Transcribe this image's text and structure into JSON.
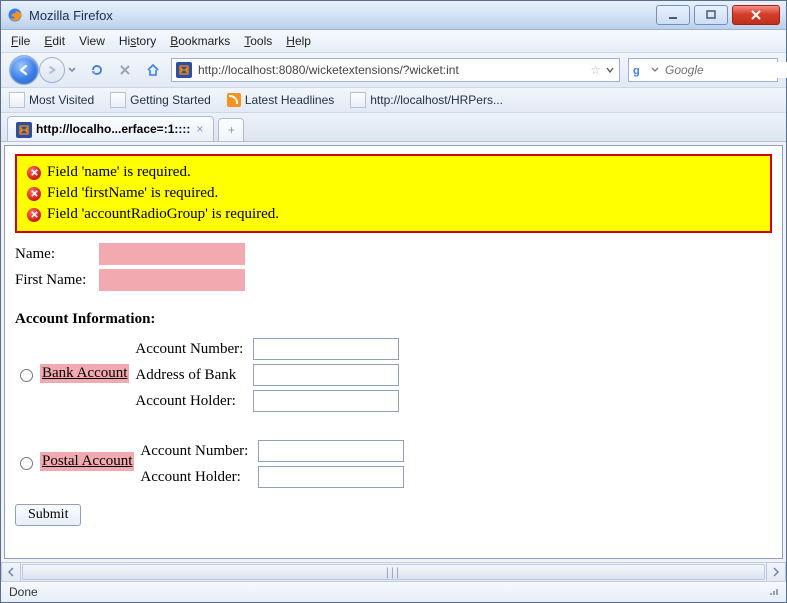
{
  "window": {
    "title": "Mozilla Firefox"
  },
  "menu": {
    "file": "File",
    "edit": "Edit",
    "view": "View",
    "history": "History",
    "bookmarks": "Bookmarks",
    "tools": "Tools",
    "help": "Help"
  },
  "nav": {
    "url": "http://localhost:8080/wicketextensions/?wicket:int",
    "search_placeholder": "Google"
  },
  "bookmarks": {
    "most_visited": "Most Visited",
    "getting_started": "Getting Started",
    "latest_headlines": "Latest Headlines",
    "hr_link": "http://localhost/HRPers..."
  },
  "tab": {
    "label": "http://localho...erface=:1::::"
  },
  "errors": {
    "e1": "Field 'name' is required.",
    "e2": "Field 'firstName' is required.",
    "e3": "Field 'accountRadioGroup' is required."
  },
  "form": {
    "name_label": "Name:",
    "firstname_label": "First Name:",
    "section_title": "Account Information:",
    "bank_radio": "Bank Account",
    "postal_radio": "Postal Account",
    "accnum": "Account Number:",
    "bank_addr": "Address of Bank",
    "holder": "Account Holder:",
    "submit": "Submit"
  },
  "status": {
    "text": "Done"
  }
}
